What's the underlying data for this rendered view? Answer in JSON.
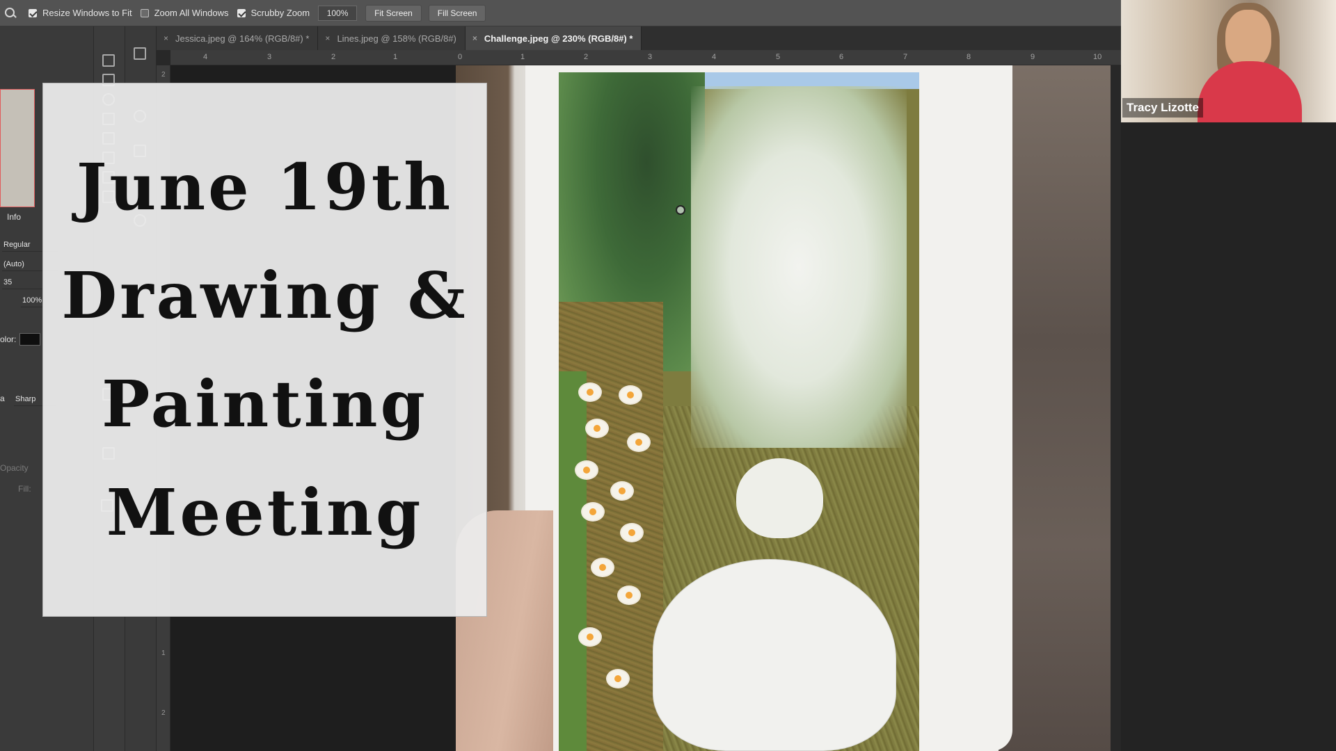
{
  "options_bar": {
    "zoom_tool_icon": "zoom-icon",
    "checks": [
      {
        "label": "Resize Windows to Fit",
        "checked": true
      },
      {
        "label": "Zoom All Windows",
        "checked": false
      },
      {
        "label": "Scrubby Zoom",
        "checked": true
      }
    ],
    "zoom_value": "100%",
    "fit_screen_label": "Fit Screen",
    "fill_screen_label": "Fill Screen"
  },
  "tabs": [
    {
      "label": "Jessica.jpeg @ 164% (RGB/8#) *",
      "active": false
    },
    {
      "label": "Lines.jpeg @ 158% (RGB/8#)",
      "active": false
    },
    {
      "label": "Challenge.jpeg @ 230% (RGB/8#) *",
      "active": true
    }
  ],
  "ruler_h": [
    "4",
    "3",
    "2",
    "1",
    "0",
    "1",
    "2",
    "3",
    "4",
    "5",
    "6",
    "7",
    "8",
    "9",
    "10"
  ],
  "ruler_v": [
    "2",
    "1",
    "2"
  ],
  "left_panel": {
    "info_label": "Info",
    "font_style": "Regular",
    "leading": "(Auto)",
    "tracking": "35",
    "scale": "100%",
    "color_label": "olor:",
    "aa_prefix": "a",
    "antialias": "Sharp",
    "opacity_label": "Opacity",
    "fill_label": "Fill:"
  },
  "overlay": {
    "lines": [
      "June 19th",
      "Drawing &",
      "Painting",
      "Meeting"
    ]
  },
  "video": {
    "participant_name": "Tracy Lizotte"
  },
  "colors": {
    "app_bg": "#282828",
    "options_bar": "#535353",
    "overlay_bg": "#ececec",
    "name_text": "#ffffff"
  }
}
